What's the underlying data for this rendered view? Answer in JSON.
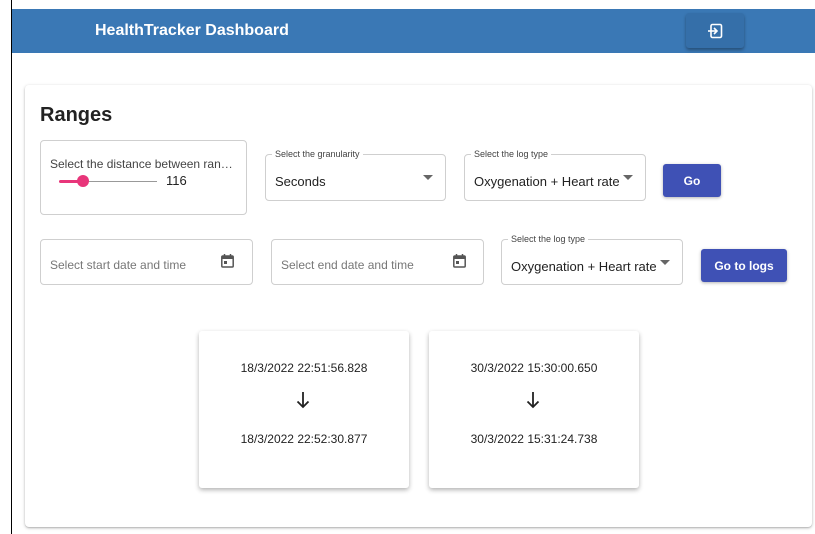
{
  "app": {
    "title": "HealthTracker Dashboard",
    "logout_icon": "logout-icon",
    "bar_color": "#3a78b5"
  },
  "ranges": {
    "title": "Ranges",
    "distance_slider": {
      "label": "Select the distance between ran…",
      "value": "116",
      "fill_fraction": 0.24,
      "accent": "#e8357a"
    },
    "granularity_select": {
      "legend": "Select the granularity",
      "value": "Seconds"
    },
    "logtype_select": {
      "legend": "Select the log type",
      "value": "Oxygenation + Heart rate"
    },
    "go_button": "Go"
  },
  "logs": {
    "start_date_placeholder": "Select start date and time",
    "end_date_placeholder": "Select end date and time",
    "logtype_select": {
      "legend": "Select the log type",
      "value": "Oxygenation + Heart rate"
    },
    "go_to_logs_button": "Go to logs",
    "button_color": "#3f51b5"
  },
  "range_results": [
    {
      "start": "18/3/2022 22:51:56.828",
      "end": "18/3/2022 22:52:30.877"
    },
    {
      "start": "30/3/2022 15:30:00.650",
      "end": "30/3/2022 15:31:24.738"
    }
  ]
}
